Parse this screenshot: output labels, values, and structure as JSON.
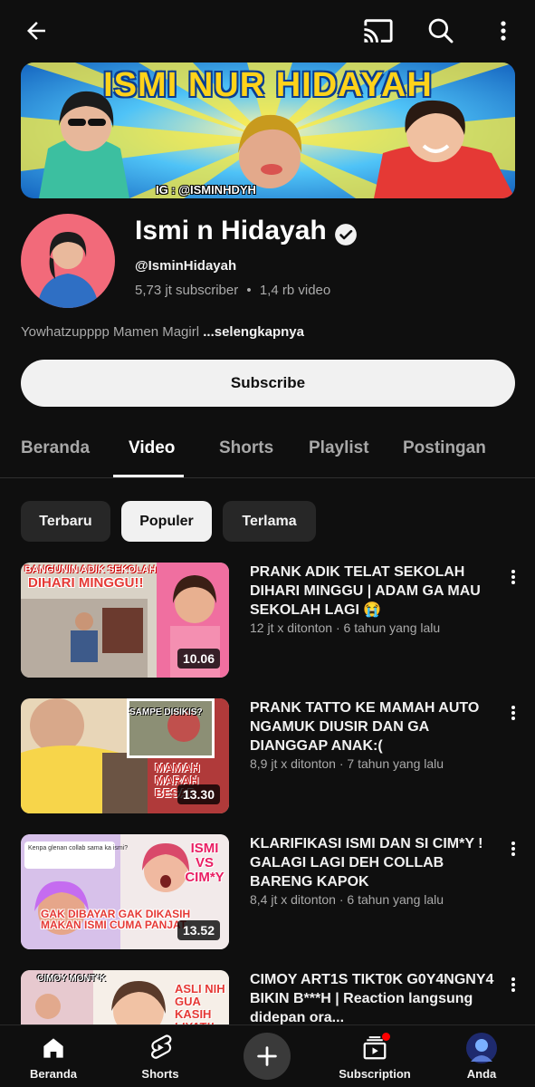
{
  "header": {
    "back_icon": "arrow-left-icon",
    "cast_icon": "cast-icon",
    "search_icon": "search-icon",
    "more_icon": "more-vert-icon"
  },
  "banner": {
    "title": "ISMI NUR HIDAYAH",
    "ig": "IG : @ISMINHDYH"
  },
  "channel": {
    "name": "Ismi n Hidayah",
    "handle": "@IsminHidayah",
    "subscribers": "5,73 jt subscriber",
    "videos": "1,4 rb video",
    "separator": "•",
    "description": "Yowhatzupppp Mamen Magirl ",
    "more_label": "...selengkapnya"
  },
  "subscribe_label": "Subscribe",
  "tabs": [
    {
      "label": "Beranda",
      "active": false
    },
    {
      "label": "Video",
      "active": true
    },
    {
      "label": "Shorts",
      "active": false
    },
    {
      "label": "Playlist",
      "active": false
    },
    {
      "label": "Postingan",
      "active": false
    }
  ],
  "chips": [
    {
      "label": "Terbaru",
      "active": false
    },
    {
      "label": "Populer",
      "active": true
    },
    {
      "label": "Terlama",
      "active": false
    }
  ],
  "videos": [
    {
      "title": "PRANK ADIK TELAT SEKOLAH DIHARI MINGGU | ADAM GA MAU SEKOLAH LAGI 😭",
      "views": "12 jt x ditonton",
      "age": "6 tahun yang lalu",
      "duration": "10.06",
      "thumb_text": "BANGUNIN ADIK SEKOLAH",
      "thumb_text2": "DIHARI MINGGU!!"
    },
    {
      "title": "PRANK TATTO KE MAMAH AUTO NGAMUK DIUSIR DAN GA DIANGGAP ANAK:(",
      "views": "8,9 jt x ditonton",
      "age": "7 tahun yang lalu",
      "duration": "13.30",
      "thumb_text": "SAMPE DISIKIS?",
      "thumb_text2": "MAMAH MARAH BESAR"
    },
    {
      "title": "KLARIFIKASI ISMI DAN SI CIM*Y ! GALAGI LAGI DEH COLLAB BARENG KAPOK",
      "views": "8,4 jt x ditonton",
      "age": "6 tahun yang lalu",
      "duration": "13.52",
      "thumb_text": "ISMI VS CIM*Y",
      "thumb_text2": "GAK DIBAYAR GAK DIKASIH MAKAN ISMI CUMA PANJAT"
    },
    {
      "title": "CIMOY ART1S TIKT0K G0Y4NGNY4 BIKIN B***H | Reaction langsung didepan ora...",
      "views": "",
      "age": "",
      "duration": "",
      "thumb_text": "CIMOY MONT*K",
      "thumb_text2": "ASLI NIH GUA KASIH LIYAT!!"
    }
  ],
  "bottom_nav": [
    {
      "label": "Beranda",
      "icon": "home-icon"
    },
    {
      "label": "Shorts",
      "icon": "shorts-icon"
    },
    {
      "label": "",
      "icon": "plus-icon"
    },
    {
      "label": "Subscription",
      "icon": "subscriptions-icon"
    },
    {
      "label": "Anda",
      "icon": "profile-avatar"
    }
  ]
}
